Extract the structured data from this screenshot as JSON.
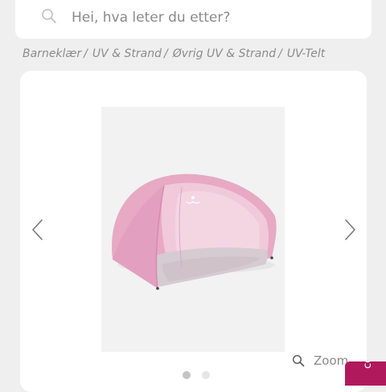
{
  "search": {
    "placeholder": "Hei, hva leter du etter?",
    "icon": "search-icon"
  },
  "breadcrumb": {
    "items": [
      {
        "label": "Barneklær"
      },
      {
        "label": "UV & Strand"
      },
      {
        "label": "Øvrig UV & Strand"
      },
      {
        "label": "UV-Telt"
      }
    ],
    "separator": "/"
  },
  "gallery": {
    "prev_icon": "chevron-left-icon",
    "next_icon": "chevron-right-icon",
    "zoom_label": "Zoom",
    "zoom_icon": "magnifier-icon",
    "image_count": 2,
    "active_image": 1
  },
  "floating_tab": {
    "label": "ce",
    "color": "#b0195b"
  },
  "colors": {
    "page_background": "#efefef",
    "card_background": "#ffffff",
    "tent_pink": "#e7a9c4",
    "accent": "#b0195b"
  }
}
